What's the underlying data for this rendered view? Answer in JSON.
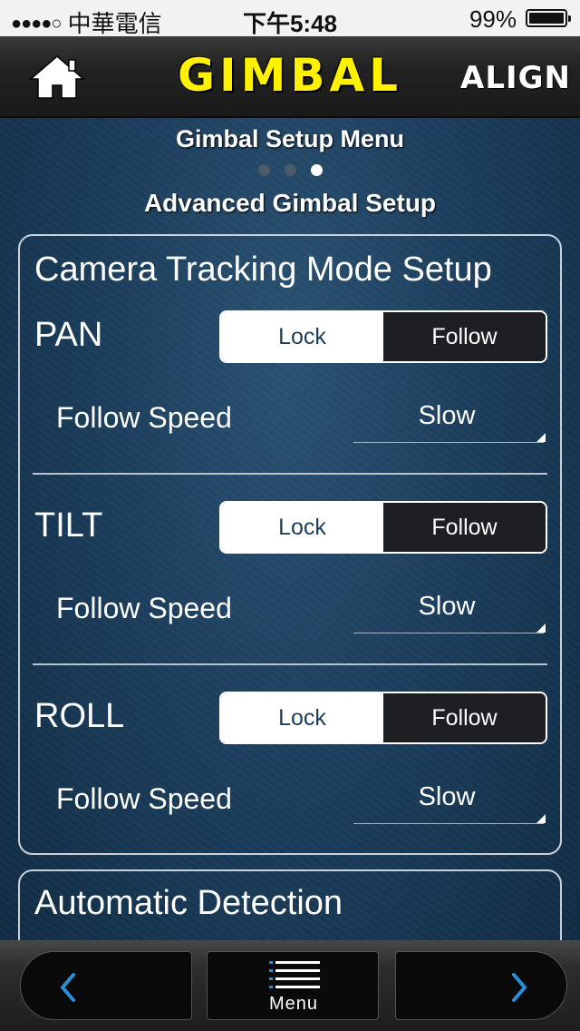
{
  "status_bar": {
    "signal_dots": "●●●●○",
    "carrier": "中華電信",
    "time": "下午5:48",
    "battery": "99%"
  },
  "header": {
    "title": "GIMBAL",
    "brand": "ALIGN"
  },
  "page": {
    "menu_title": "Gimbal Setup Menu",
    "pager_total": 3,
    "pager_active": 3,
    "subtitle": "Advanced Gimbal Setup"
  },
  "tracking_panel": {
    "title": "Camera Tracking Mode Setup",
    "axes": [
      {
        "name": "PAN",
        "options": [
          "Lock",
          "Follow"
        ],
        "selected": "Lock",
        "speed_label": "Follow Speed",
        "speed_value": "Slow"
      },
      {
        "name": "TILT",
        "options": [
          "Lock",
          "Follow"
        ],
        "selected": "Lock",
        "speed_label": "Follow Speed",
        "speed_value": "Slow"
      },
      {
        "name": "ROLL",
        "options": [
          "Lock",
          "Follow"
        ],
        "selected": "Lock",
        "speed_label": "Follow Speed",
        "speed_value": "Slow"
      }
    ]
  },
  "detection_panel": {
    "title": "Automatic Detection"
  },
  "footer": {
    "prev_icon": "chevron-left-icon",
    "menu_label": "Menu",
    "menu_icon": "hamburger-menu-icon",
    "next_icon": "chevron-right-icon",
    "accent": "#2a8fd6"
  },
  "colors": {
    "title_yellow": "#fff200",
    "selected_segment": "#ffffff",
    "unselected_segment": "#1d1f22"
  }
}
